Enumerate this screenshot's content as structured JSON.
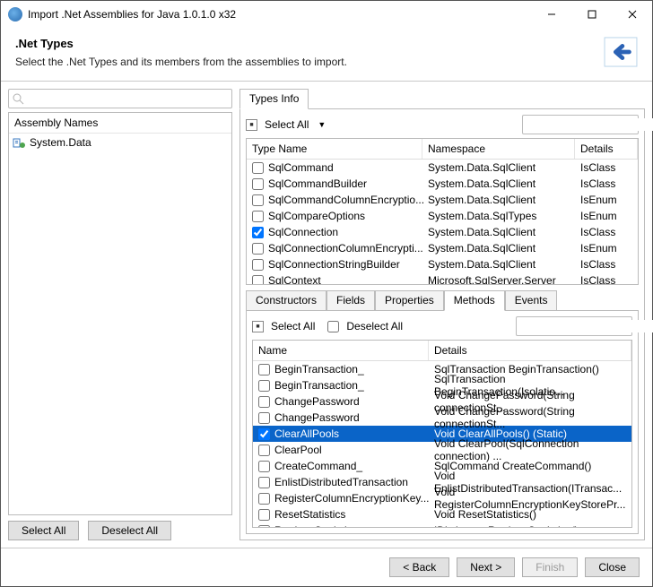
{
  "window": {
    "title": "Import .Net Assemblies for Java 1.0.1.0 x32"
  },
  "header": {
    "title": ".Net Types",
    "subtitle": "Select the .Net Types and its members from the assemblies to import."
  },
  "leftPanel": {
    "heading": "Assembly Names",
    "items": [
      {
        "label": "System.Data"
      }
    ],
    "selectAll": "Select All",
    "deselectAll": "Deselect All"
  },
  "typesTab": {
    "label": "Types Info",
    "selectAll": "Select All",
    "columns": {
      "name": "Type Name",
      "ns": "Namespace",
      "details": "Details"
    },
    "rows": [
      {
        "name": "SqlCommand",
        "ns": "System.Data.SqlClient",
        "details": "IsClass",
        "checked": false
      },
      {
        "name": "SqlCommandBuilder",
        "ns": "System.Data.SqlClient",
        "details": "IsClass",
        "checked": false
      },
      {
        "name": "SqlCommandColumnEncryptio...",
        "ns": "System.Data.SqlClient",
        "details": "IsEnum",
        "checked": false
      },
      {
        "name": "SqlCompareOptions",
        "ns": "System.Data.SqlTypes",
        "details": "IsEnum",
        "checked": false
      },
      {
        "name": "SqlConnection",
        "ns": "System.Data.SqlClient",
        "details": "IsClass",
        "checked": true
      },
      {
        "name": "SqlConnectionColumnEncrypti...",
        "ns": "System.Data.SqlClient",
        "details": "IsEnum",
        "checked": false
      },
      {
        "name": "SqlConnectionStringBuilder",
        "ns": "System.Data.SqlClient",
        "details": "IsClass",
        "checked": false
      },
      {
        "name": "SqlContext",
        "ns": "Microsoft.SqlServer.Server",
        "details": "IsClass",
        "checked": false
      }
    ]
  },
  "memberTabs": {
    "constructors": "Constructors",
    "fields": "Fields",
    "properties": "Properties",
    "methods": "Methods",
    "events": "Events",
    "active": "methods"
  },
  "methodsPanel": {
    "selectAll": "Select All",
    "deselectAll": "Deselect All",
    "columns": {
      "name": "Name",
      "details": "Details"
    },
    "rows": [
      {
        "name": "BeginTransaction_",
        "details": "SqlTransaction BeginTransaction()",
        "checked": false
      },
      {
        "name": "BeginTransaction_",
        "details": "SqlTransaction BeginTransaction(Isolatio...",
        "checked": false
      },
      {
        "name": "ChangePassword",
        "details": "Void ChangePassword(String connectionSt...",
        "checked": false
      },
      {
        "name": "ChangePassword",
        "details": "Void ChangePassword(String connectionSt...",
        "checked": false
      },
      {
        "name": "ClearAllPools",
        "details": "Void ClearAllPools() (Static)",
        "checked": true,
        "selected": true
      },
      {
        "name": "ClearPool",
        "details": "Void ClearPool(SqlConnection connection) ...",
        "checked": false
      },
      {
        "name": "CreateCommand_",
        "details": "SqlCommand CreateCommand()",
        "checked": false
      },
      {
        "name": "EnlistDistributedTransaction",
        "details": "Void EnlistDistributedTransaction(ITransac...",
        "checked": false
      },
      {
        "name": "RegisterColumnEncryptionKey...",
        "details": "Void RegisterColumnEncryptionKeyStorePr...",
        "checked": false
      },
      {
        "name": "ResetStatistics",
        "details": "Void ResetStatistics()",
        "checked": false
      },
      {
        "name": "RetrieveStatistics",
        "details": "IDictionary RetrieveStatistics()",
        "checked": false
      }
    ]
  },
  "footer": {
    "back": "< Back",
    "next": "Next >",
    "finish": "Finish",
    "close": "Close"
  }
}
